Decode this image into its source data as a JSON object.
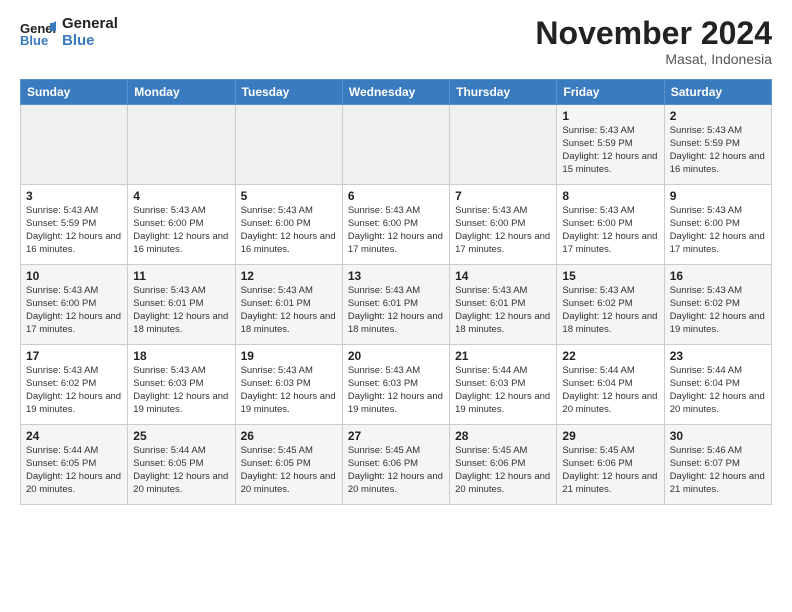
{
  "header": {
    "logo_line1": "General",
    "logo_line2": "Blue",
    "month_title": "November 2024",
    "location": "Masat, Indonesia"
  },
  "weekdays": [
    "Sunday",
    "Monday",
    "Tuesday",
    "Wednesday",
    "Thursday",
    "Friday",
    "Saturday"
  ],
  "weeks": [
    [
      {
        "day": "",
        "info": ""
      },
      {
        "day": "",
        "info": ""
      },
      {
        "day": "",
        "info": ""
      },
      {
        "day": "",
        "info": ""
      },
      {
        "day": "",
        "info": ""
      },
      {
        "day": "1",
        "info": "Sunrise: 5:43 AM\nSunset: 5:59 PM\nDaylight: 12 hours\nand 15 minutes."
      },
      {
        "day": "2",
        "info": "Sunrise: 5:43 AM\nSunset: 5:59 PM\nDaylight: 12 hours\nand 16 minutes."
      }
    ],
    [
      {
        "day": "3",
        "info": "Sunrise: 5:43 AM\nSunset: 5:59 PM\nDaylight: 12 hours\nand 16 minutes."
      },
      {
        "day": "4",
        "info": "Sunrise: 5:43 AM\nSunset: 6:00 PM\nDaylight: 12 hours\nand 16 minutes."
      },
      {
        "day": "5",
        "info": "Sunrise: 5:43 AM\nSunset: 6:00 PM\nDaylight: 12 hours\nand 16 minutes."
      },
      {
        "day": "6",
        "info": "Sunrise: 5:43 AM\nSunset: 6:00 PM\nDaylight: 12 hours\nand 17 minutes."
      },
      {
        "day": "7",
        "info": "Sunrise: 5:43 AM\nSunset: 6:00 PM\nDaylight: 12 hours\nand 17 minutes."
      },
      {
        "day": "8",
        "info": "Sunrise: 5:43 AM\nSunset: 6:00 PM\nDaylight: 12 hours\nand 17 minutes."
      },
      {
        "day": "9",
        "info": "Sunrise: 5:43 AM\nSunset: 6:00 PM\nDaylight: 12 hours\nand 17 minutes."
      }
    ],
    [
      {
        "day": "10",
        "info": "Sunrise: 5:43 AM\nSunset: 6:00 PM\nDaylight: 12 hours\nand 17 minutes."
      },
      {
        "day": "11",
        "info": "Sunrise: 5:43 AM\nSunset: 6:01 PM\nDaylight: 12 hours\nand 18 minutes."
      },
      {
        "day": "12",
        "info": "Sunrise: 5:43 AM\nSunset: 6:01 PM\nDaylight: 12 hours\nand 18 minutes."
      },
      {
        "day": "13",
        "info": "Sunrise: 5:43 AM\nSunset: 6:01 PM\nDaylight: 12 hours\nand 18 minutes."
      },
      {
        "day": "14",
        "info": "Sunrise: 5:43 AM\nSunset: 6:01 PM\nDaylight: 12 hours\nand 18 minutes."
      },
      {
        "day": "15",
        "info": "Sunrise: 5:43 AM\nSunset: 6:02 PM\nDaylight: 12 hours\nand 18 minutes."
      },
      {
        "day": "16",
        "info": "Sunrise: 5:43 AM\nSunset: 6:02 PM\nDaylight: 12 hours\nand 19 minutes."
      }
    ],
    [
      {
        "day": "17",
        "info": "Sunrise: 5:43 AM\nSunset: 6:02 PM\nDaylight: 12 hours\nand 19 minutes."
      },
      {
        "day": "18",
        "info": "Sunrise: 5:43 AM\nSunset: 6:03 PM\nDaylight: 12 hours\nand 19 minutes."
      },
      {
        "day": "19",
        "info": "Sunrise: 5:43 AM\nSunset: 6:03 PM\nDaylight: 12 hours\nand 19 minutes."
      },
      {
        "day": "20",
        "info": "Sunrise: 5:43 AM\nSunset: 6:03 PM\nDaylight: 12 hours\nand 19 minutes."
      },
      {
        "day": "21",
        "info": "Sunrise: 5:44 AM\nSunset: 6:03 PM\nDaylight: 12 hours\nand 19 minutes."
      },
      {
        "day": "22",
        "info": "Sunrise: 5:44 AM\nSunset: 6:04 PM\nDaylight: 12 hours\nand 20 minutes."
      },
      {
        "day": "23",
        "info": "Sunrise: 5:44 AM\nSunset: 6:04 PM\nDaylight: 12 hours\nand 20 minutes."
      }
    ],
    [
      {
        "day": "24",
        "info": "Sunrise: 5:44 AM\nSunset: 6:05 PM\nDaylight: 12 hours\nand 20 minutes."
      },
      {
        "day": "25",
        "info": "Sunrise: 5:44 AM\nSunset: 6:05 PM\nDaylight: 12 hours\nand 20 minutes."
      },
      {
        "day": "26",
        "info": "Sunrise: 5:45 AM\nSunset: 6:05 PM\nDaylight: 12 hours\nand 20 minutes."
      },
      {
        "day": "27",
        "info": "Sunrise: 5:45 AM\nSunset: 6:06 PM\nDaylight: 12 hours\nand 20 minutes."
      },
      {
        "day": "28",
        "info": "Sunrise: 5:45 AM\nSunset: 6:06 PM\nDaylight: 12 hours\nand 20 minutes."
      },
      {
        "day": "29",
        "info": "Sunrise: 5:45 AM\nSunset: 6:06 PM\nDaylight: 12 hours\nand 21 minutes."
      },
      {
        "day": "30",
        "info": "Sunrise: 5:46 AM\nSunset: 6:07 PM\nDaylight: 12 hours\nand 21 minutes."
      }
    ]
  ]
}
